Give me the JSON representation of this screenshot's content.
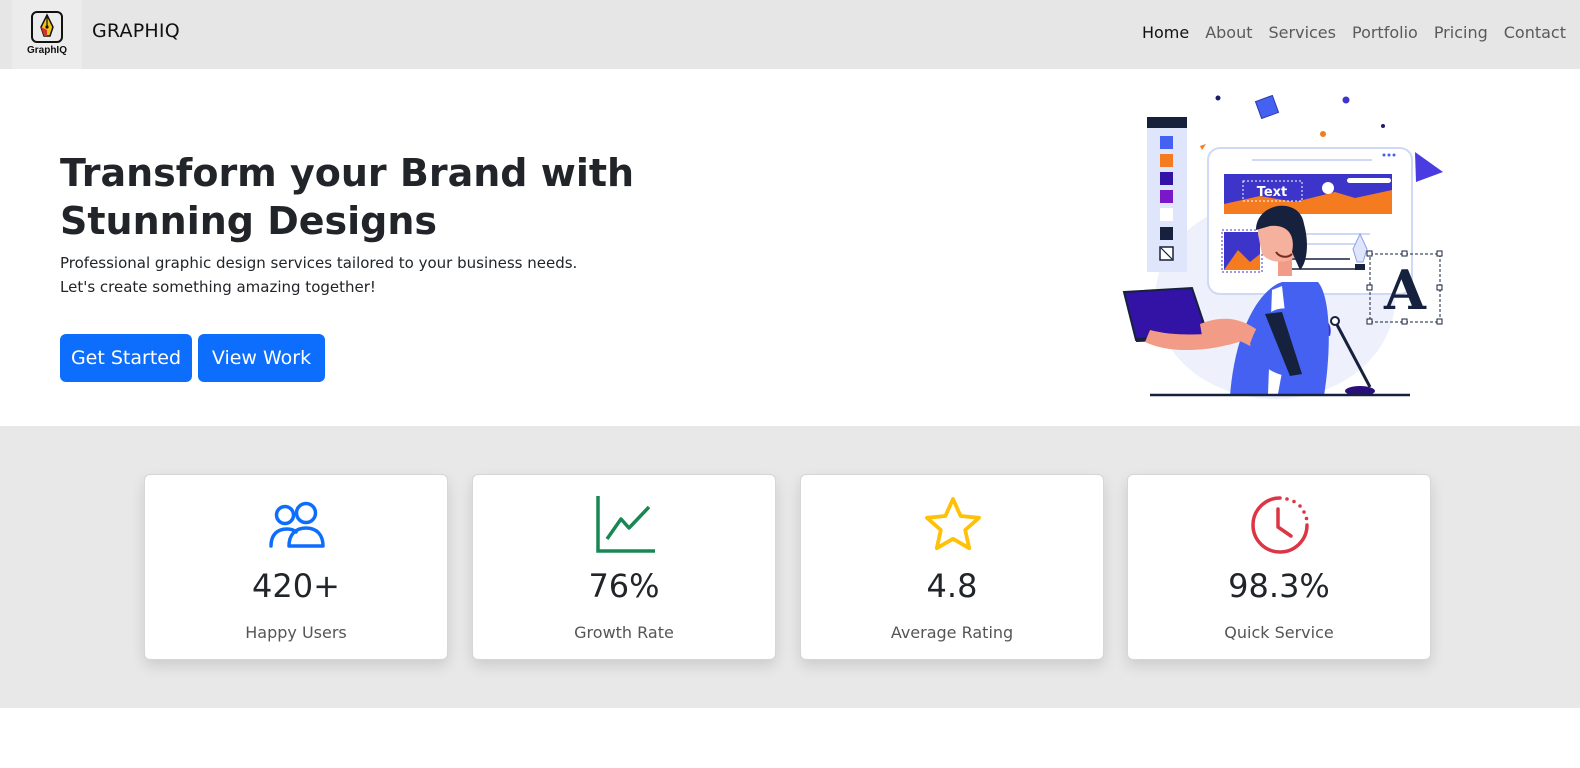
{
  "brand": {
    "logo_text": "GraphIQ",
    "name": "GRAPHIQ"
  },
  "nav": {
    "items": [
      {
        "label": "Home",
        "active": true
      },
      {
        "label": "About"
      },
      {
        "label": "Services"
      },
      {
        "label": "Portfolio"
      },
      {
        "label": "Pricing"
      },
      {
        "label": "Contact"
      }
    ]
  },
  "hero": {
    "title": "Transform your Brand with Stunning Designs",
    "subtitle": "Professional graphic design services tailored to your business needs. Let's create something amazing together!",
    "primary_button": "Get Started",
    "secondary_button": "View Work",
    "illustration": {
      "icon": "designer-illustration",
      "text_box": "Text",
      "letter": "A"
    }
  },
  "stats": [
    {
      "icon": "users-icon",
      "value": "420+",
      "label": "Happy Users",
      "color": "#0d6efd"
    },
    {
      "icon": "graph-up-icon",
      "value": "76%",
      "label": "Growth Rate",
      "color": "#198754"
    },
    {
      "icon": "star-icon",
      "value": "4.8",
      "label": "Average Rating",
      "color": "#ffc107"
    },
    {
      "icon": "clock-icon",
      "value": "98.3%",
      "label": "Quick Service",
      "color": "#dc3545"
    }
  ],
  "colors": {
    "primary": "#0d6efd",
    "navbar_bg": "#e6e6e6",
    "stats_bg": "#e8e8e8"
  }
}
